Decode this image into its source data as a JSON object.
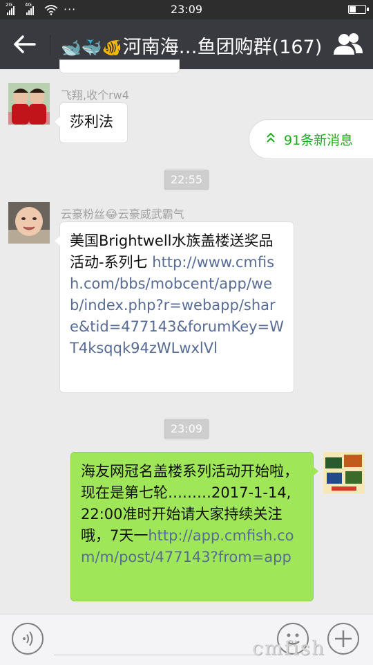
{
  "status_bar": {
    "time": "23:09",
    "signal1_label": "2G",
    "signal2_label": "4G",
    "more": "···",
    "battery_level": 0.45
  },
  "header": {
    "emoji": "🐋🐳🐠",
    "title": "河南海…鱼团购群(167)"
  },
  "unread": {
    "text": "91条新消息"
  },
  "messages": [
    {
      "sender": "飞翔,收个rw4",
      "text": "莎利法"
    },
    {
      "time": "22:55"
    },
    {
      "sender_text": "云豪粉丝",
      "sender_emoji": "😂",
      "sender_suffix": "云豪威武霸气",
      "text": "美国Brightwell水族盖楼送奖品活动-系列七 ",
      "link": "http://www.cmfish.com/bbs/mobcent/app/web/index.php?r=webapp/share&tid=477143&forumKey=WT4ksqqk94zWLwxlVl"
    },
    {
      "time": "23:09"
    },
    {
      "text": "海友网冠名盖楼系列活动开始啦，现在是第七轮………2017-1-14, 22:00准时开始请大家持续关注哦，7天一",
      "link": "http://app.cmfish.com/m/post/477143?from=app"
    }
  ],
  "colors": {
    "title_bar": "#393a3f",
    "background": "#ebebeb",
    "own_bubble": "#9fe658",
    "link": "#576b95",
    "unread_text": "#1aad19"
  },
  "watermark": "cmfish"
}
